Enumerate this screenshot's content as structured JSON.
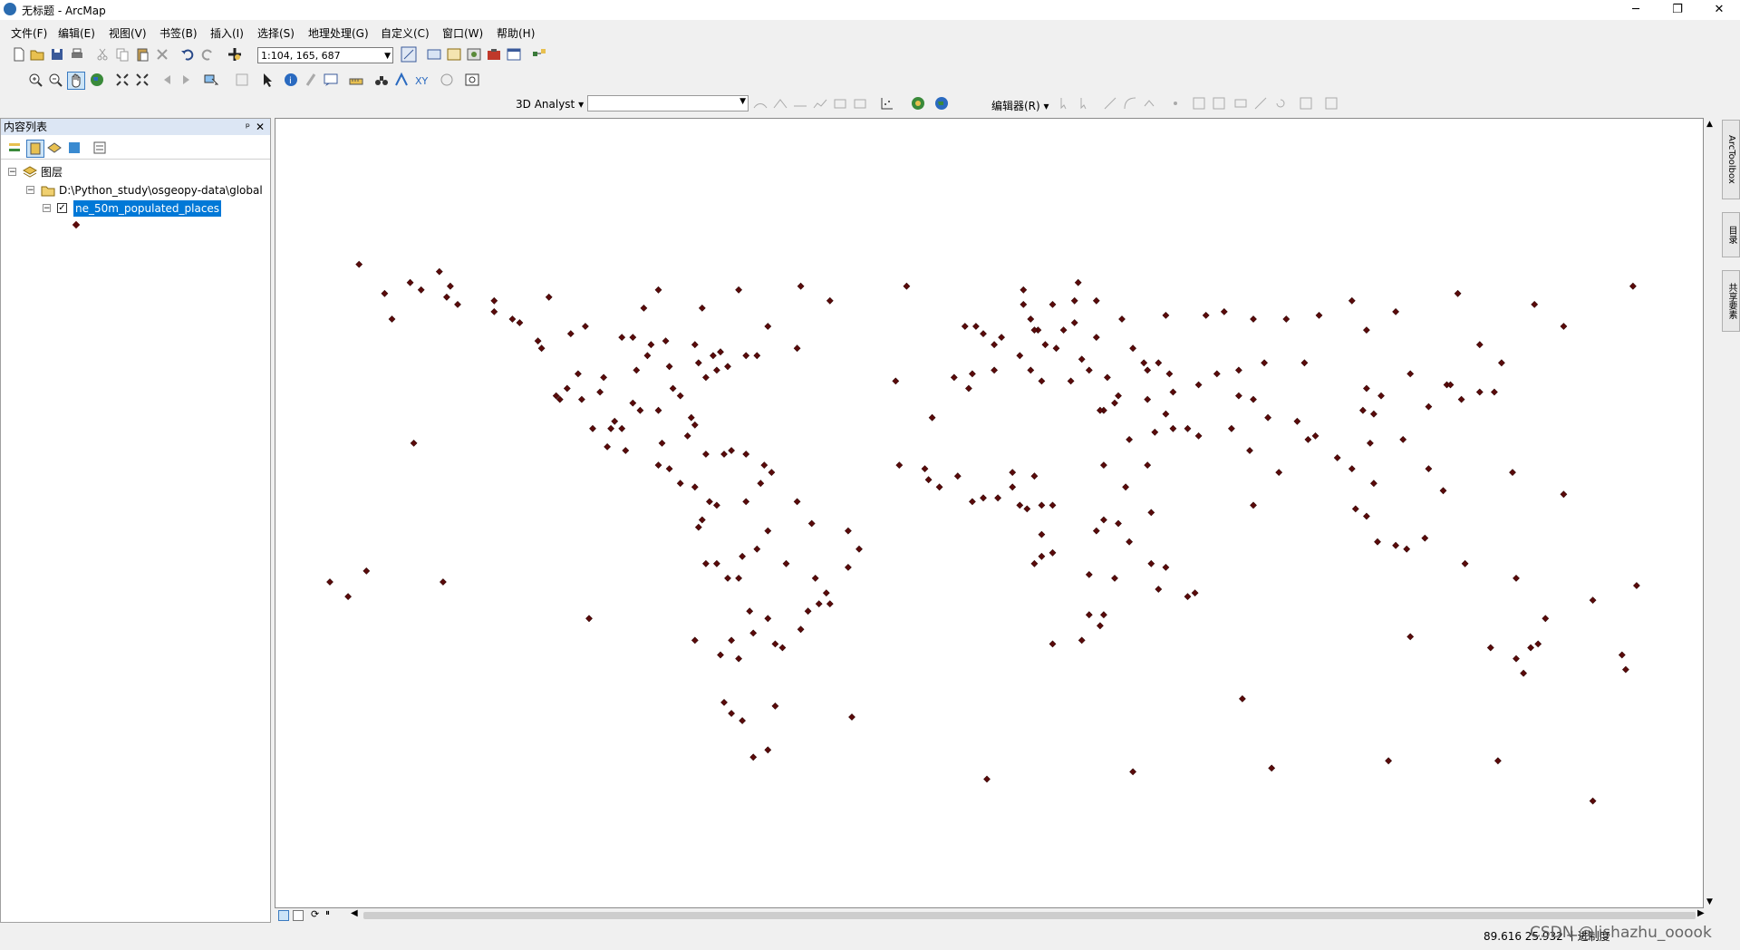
{
  "window": {
    "title": "无标题 - ArcMap",
    "min": "─",
    "restore": "❐",
    "close": "✕"
  },
  "menu": [
    "文件(F)",
    "编辑(E)",
    "视图(V)",
    "书签(B)",
    "插入(I)",
    "选择(S)",
    "地理处理(G)",
    "自定义(C)",
    "窗口(W)",
    "帮助(H)"
  ],
  "toolbar": {
    "scale_value": "1:104, 165, 687",
    "analyst_label": "3D Analyst ▾",
    "editor_label": "编辑器(R) ▾"
  },
  "toc": {
    "title": "内容列表",
    "pin": "ᵖ",
    "close": "✕",
    "root_layer": "图层",
    "folder": "D:\\Python_study\\osgeopy-data\\global",
    "layer": "ne_50m_populated_places",
    "checkbox_mark": "✓",
    "minus": "−"
  },
  "side_tabs": [
    "ArcToolbox",
    "目录",
    "共享要素"
  ],
  "status": {
    "coordinates": "89.616  25.932 十进制度"
  },
  "watermark": "CSDN @lishazhu_ooook",
  "colors": {
    "point_fill": "#5a0a0a",
    "selection": "#0078d7"
  },
  "map_points": [
    [
      -172,
      70
    ],
    [
      -165,
      62
    ],
    [
      -150,
      68
    ],
    [
      -148,
      61
    ],
    [
      -135,
      57
    ],
    [
      -163,
      55
    ],
    [
      -155,
      63
    ],
    [
      -145,
      59
    ],
    [
      -158,
      65
    ],
    [
      -123,
      49
    ],
    [
      -122,
      47
    ],
    [
      -118,
      34
    ],
    [
      -117,
      33
    ],
    [
      -112,
      40
    ],
    [
      -105,
      39
    ],
    [
      -97,
      32
    ],
    [
      -95,
      30
    ],
    [
      -90,
      30
    ],
    [
      -87,
      42
    ],
    [
      -84,
      34
    ],
    [
      -80,
      26
    ],
    [
      -77,
      39
    ],
    [
      -74,
      41
    ],
    [
      -71,
      42
    ],
    [
      -73,
      46
    ],
    [
      -75,
      45
    ],
    [
      -79,
      43
    ],
    [
      -81,
      28
    ],
    [
      -86,
      36
    ],
    [
      -93,
      45
    ],
    [
      -96,
      41
    ],
    [
      -106,
      35
    ],
    [
      -111,
      33
    ],
    [
      -115,
      36
    ],
    [
      -104,
      20
    ],
    [
      -99,
      19
    ],
    [
      -100,
      25
    ],
    [
      -103,
      25
    ],
    [
      -89,
      21
    ],
    [
      -90,
      15
    ],
    [
      -87,
      14
    ],
    [
      -84,
      10
    ],
    [
      -80,
      9
    ],
    [
      -76,
      5
    ],
    [
      -74,
      4
    ],
    [
      -78,
      0
    ],
    [
      -79,
      -2
    ],
    [
      -77,
      -12
    ],
    [
      -71,
      -16
    ],
    [
      -68,
      -16
    ],
    [
      -70,
      -33
    ],
    [
      -73,
      -37
    ],
    [
      -58,
      -34
    ],
    [
      -56,
      -35
    ],
    [
      -64,
      -31
    ],
    [
      -65,
      -25
    ],
    [
      -60,
      -3
    ],
    [
      -48,
      -1
    ],
    [
      -38,
      -3
    ],
    [
      -35,
      -8
    ],
    [
      -38,
      -13
    ],
    [
      -43,
      -23
    ],
    [
      -46,
      -23
    ],
    [
      -49,
      -25
    ],
    [
      -51,
      -30
    ],
    [
      -47,
      -16
    ],
    [
      -44,
      -20
    ],
    [
      -55,
      -12
    ],
    [
      -63,
      -8
    ],
    [
      -67,
      -10
    ],
    [
      -72,
      -50
    ],
    [
      -70,
      -53
    ],
    [
      -68,
      -38
    ],
    [
      -66,
      5
    ],
    [
      -62,
      10
    ],
    [
      -66,
      18
    ],
    [
      -70,
      19
    ],
    [
      -72,
      18
    ],
    [
      -77,
      18
    ],
    [
      -82,
      23
    ],
    [
      -61,
      15
    ],
    [
      -59,
      13
    ],
    [
      -52,
      5
    ],
    [
      -135,
      60
    ],
    [
      -147,
      64
    ],
    [
      -114,
      51
    ],
    [
      -110,
      53
    ],
    [
      -100,
      50
    ],
    [
      -97,
      50
    ],
    [
      -92,
      48
    ],
    [
      -88,
      49
    ],
    [
      -80,
      48
    ],
    [
      -66,
      45
    ],
    [
      -63,
      45
    ],
    [
      -52,
      47
    ],
    [
      -60,
      53
    ],
    [
      -78,
      58
    ],
    [
      -94,
      58
    ],
    [
      -68,
      63
    ],
    [
      -51,
      64
    ],
    [
      -43,
      60
    ],
    [
      -22,
      64
    ],
    [
      -15,
      28
    ],
    [
      -17,
      14
    ],
    [
      -16,
      11
    ],
    [
      -13,
      9
    ],
    [
      -8,
      12
    ],
    [
      -4,
      5
    ],
    [
      -1,
      6
    ],
    [
      3,
      6
    ],
    [
      7,
      9
    ],
    [
      7,
      13
    ],
    [
      13,
      12
    ],
    [
      15,
      4
    ],
    [
      18,
      4
    ],
    [
      9,
      4
    ],
    [
      11,
      3
    ],
    [
      15,
      -4
    ],
    [
      15,
      -10
    ],
    [
      13,
      -12
    ],
    [
      18,
      -9
    ],
    [
      28,
      -15
    ],
    [
      32,
      -26
    ],
    [
      28,
      -26
    ],
    [
      18,
      -34
    ],
    [
      26,
      -33
    ],
    [
      31,
      -29
    ],
    [
      35,
      -16
    ],
    [
      39,
      -6
    ],
    [
      36,
      -1
    ],
    [
      45,
      2
    ],
    [
      32,
      0
    ],
    [
      30,
      -3
    ],
    [
      38,
      9
    ],
    [
      32,
      15
    ],
    [
      32,
      30
    ],
    [
      31,
      30
    ],
    [
      36,
      34
    ],
    [
      35,
      32
    ],
    [
      44,
      33
    ],
    [
      51,
      35
    ],
    [
      46,
      24
    ],
    [
      39,
      22
    ],
    [
      44,
      15
    ],
    [
      58,
      23
    ],
    [
      55,
      25
    ],
    [
      51,
      25
    ],
    [
      49,
      29
    ],
    [
      67,
      25
    ],
    [
      73,
      33
    ],
    [
      69,
      34
    ],
    [
      72,
      19
    ],
    [
      77,
      28
    ],
    [
      80,
      13
    ],
    [
      88,
      22
    ],
    [
      85,
      27
    ],
    [
      90,
      23
    ],
    [
      96,
      17
    ],
    [
      100,
      14
    ],
    [
      105,
      21
    ],
    [
      106,
      10
    ],
    [
      101,
      3
    ],
    [
      104,
      1
    ],
    [
      107,
      -6
    ],
    [
      112,
      -7
    ],
    [
      115,
      -8
    ],
    [
      120,
      -5
    ],
    [
      125,
      8
    ],
    [
      121,
      14
    ],
    [
      114,
      22
    ],
    [
      121,
      31
    ],
    [
      116,
      40
    ],
    [
      126,
      37
    ],
    [
      127,
      37
    ],
    [
      139,
      35
    ],
    [
      135,
      35
    ],
    [
      141,
      43
    ],
    [
      130,
      33
    ],
    [
      103,
      30
    ],
    [
      106,
      29
    ],
    [
      108,
      34
    ],
    [
      104,
      36
    ],
    [
      87,
      43
    ],
    [
      76,
      43
    ],
    [
      69,
      41
    ],
    [
      63,
      40
    ],
    [
      58,
      37
    ],
    [
      50,
      40
    ],
    [
      44,
      41
    ],
    [
      37,
      55
    ],
    [
      30,
      60
    ],
    [
      24,
      60
    ],
    [
      18,
      59
    ],
    [
      10,
      59
    ],
    [
      10,
      63
    ],
    [
      25,
      65
    ],
    [
      30,
      50
    ],
    [
      24,
      54
    ],
    [
      21,
      52
    ],
    [
      14,
      52
    ],
    [
      12,
      55
    ],
    [
      4,
      50
    ],
    [
      2,
      48
    ],
    [
      -1,
      51
    ],
    [
      -3,
      53
    ],
    [
      -6,
      53
    ],
    [
      -9,
      39
    ],
    [
      -4,
      40
    ],
    [
      2,
      41
    ],
    [
      9,
      45
    ],
    [
      12,
      41
    ],
    [
      15,
      38
    ],
    [
      23,
      38
    ],
    [
      28,
      41
    ],
    [
      33,
      39
    ],
    [
      26,
      44
    ],
    [
      19,
      47
    ],
    [
      16,
      48
    ],
    [
      13,
      52
    ],
    [
      -74,
      -12
    ],
    [
      -60,
      -27
    ],
    [
      149,
      -35
    ],
    [
      151,
      -34
    ],
    [
      153,
      -27
    ],
    [
      145,
      -38
    ],
    [
      138,
      -35
    ],
    [
      116,
      -32
    ],
    [
      131,
      -12
    ],
    [
      145,
      -16
    ],
    [
      147,
      -42
    ],
    [
      175,
      -41
    ],
    [
      174,
      -37
    ],
    [
      178,
      -18
    ],
    [
      166,
      -22
    ],
    [
      158,
      7
    ],
    [
      144,
      13
    ],
    [
      -157,
      21
    ],
    [
      -149,
      -17
    ],
    [
      -109,
      -27
    ],
    [
      -80,
      -33
    ],
    [
      -58,
      -51
    ],
    [
      -37,
      -54
    ],
    [
      70,
      -49
    ],
    [
      166,
      -77
    ],
    [
      -64,
      -65
    ],
    [
      0,
      -71
    ],
    [
      40,
      -69
    ],
    [
      78,
      -68
    ],
    [
      140,
      -66
    ],
    [
      110,
      -66
    ],
    [
      -60,
      -63
    ],
    [
      -180,
      -17
    ],
    [
      -175,
      -21
    ],
    [
      -170,
      -14
    ],
    [
      57,
      -20
    ],
    [
      55,
      -21
    ],
    [
      47,
      -19
    ],
    [
      49,
      -13
    ],
    [
      73,
      4
    ],
    [
      45,
      -12
    ],
    [
      -24,
      15
    ],
    [
      -25,
      38
    ],
    [
      -5,
      36
    ],
    [
      -67,
      -55
    ],
    [
      100,
      60
    ],
    [
      129,
      62
    ],
    [
      135,
      48
    ],
    [
      150,
      59
    ],
    [
      158,
      53
    ],
    [
      177,
      64
    ],
    [
      112,
      57
    ],
    [
      104,
      52
    ],
    [
      91,
      56
    ],
    [
      82,
      55
    ],
    [
      73,
      55
    ],
    [
      65,
      57
    ],
    [
      60,
      56
    ],
    [
      49,
      56
    ],
    [
      40,
      47
    ],
    [
      47,
      43
    ],
    [
      43,
      43
    ],
    [
      -90,
      63
    ],
    [
      -120,
      61
    ],
    [
      -128,
      54
    ],
    [
      -130,
      55
    ],
    [
      -102,
      27
    ],
    [
      -108,
      25
    ]
  ]
}
